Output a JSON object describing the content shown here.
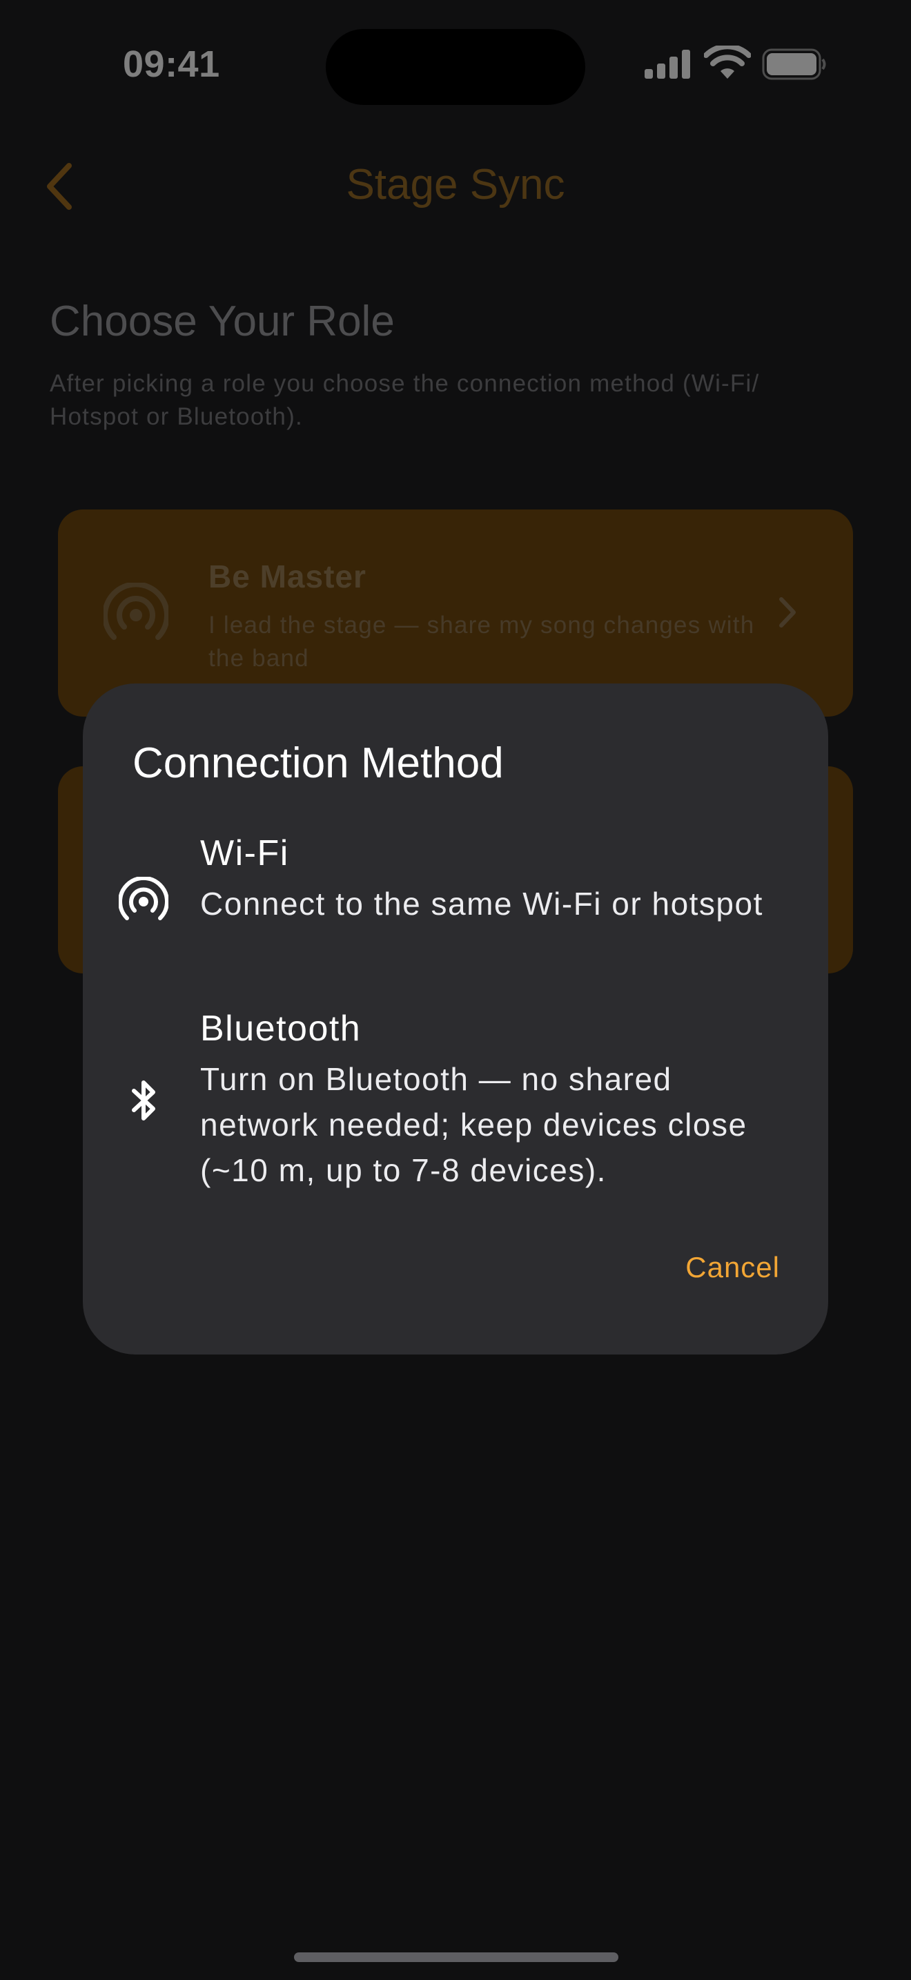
{
  "status_bar": {
    "time": "09:41"
  },
  "nav": {
    "title": "Stage Sync",
    "back_icon": "chevron-left-icon"
  },
  "header": {
    "heading": "Choose Your Role",
    "subtitle": "After picking a role you choose the connection method (Wi-Fi/ Hotspot or Bluetooth)."
  },
  "roles": [
    {
      "title": "Be Master",
      "description": "I lead the stage — share my song changes with the band",
      "icon": "broadcast-icon"
    }
  ],
  "dialog": {
    "title": "Connection Method",
    "options": [
      {
        "title": "Wi-Fi",
        "description": "Connect to the same Wi-Fi or hotspot",
        "icon": "broadcast-icon"
      },
      {
        "title": "Bluetooth",
        "description": "Turn on Bluetooth — no shared network needed; keep devices close (~10 m, up to 7-8 devices).",
        "icon": "bluetooth-icon"
      }
    ],
    "cancel_label": "Cancel"
  },
  "colors": {
    "accent": "#f2a635",
    "card_background": "#70490f",
    "dialog_background": "#2c2c2f",
    "screen_background": "#1f1f21"
  }
}
